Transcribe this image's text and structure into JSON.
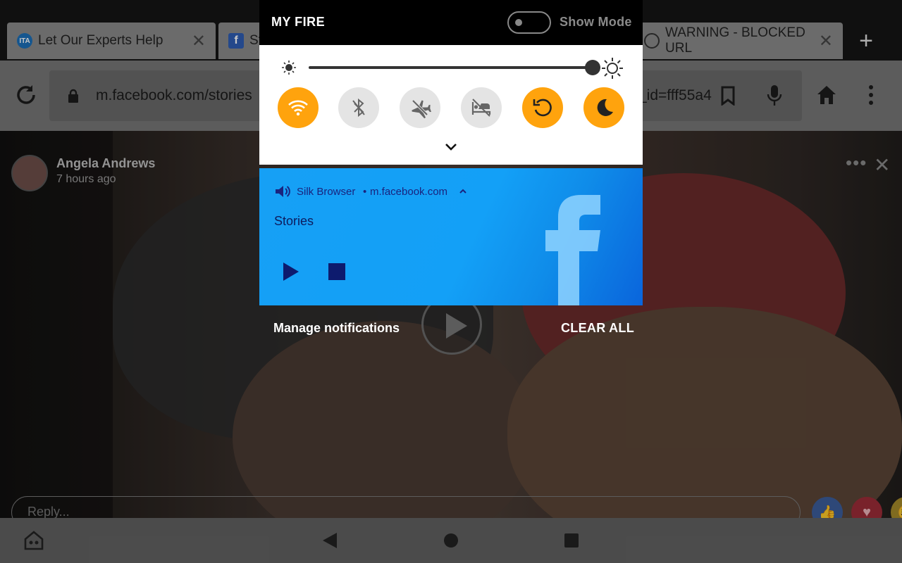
{
  "tabs": [
    {
      "label": "Let Our Experts Help",
      "icon": "ita-favicon",
      "favicon_text": "ITA"
    },
    {
      "label": "St",
      "icon": "facebook-favicon",
      "favicon_text": "f"
    },
    {
      "label": "WARNING - BLOCKED URL",
      "icon": "warning-favicon",
      "favicon_text": ""
    }
  ],
  "tab_close_glyph": "✕",
  "new_tab_glyph": "+",
  "address_bar": {
    "url_start": "m.facebook.com/stories",
    "url_end": "_id=fff55a4"
  },
  "story": {
    "author": "Angela Andrews",
    "time": "7 hours ago",
    "more_glyph": "•••",
    "close_glyph": "✕",
    "reply_placeholder": "Reply..."
  },
  "reactions": {
    "like": "👍",
    "love": "♥",
    "haha": "😆"
  },
  "shade": {
    "title": "MY FIRE",
    "show_mode_label": "Show Mode",
    "show_mode_on": false,
    "brightness_level": 1.0,
    "quick_settings": [
      {
        "name": "wifi",
        "on": true
      },
      {
        "name": "bluetooth",
        "on": false
      },
      {
        "name": "airplane-mode",
        "on": false
      },
      {
        "name": "do-not-disturb-bed",
        "on": false
      },
      {
        "name": "auto-rotate",
        "on": true
      },
      {
        "name": "blue-shade",
        "on": true
      }
    ],
    "accent_color": "#ffa30d"
  },
  "media_notification": {
    "app": "Silk Browser",
    "separator": "•",
    "site": "m.facebook.com",
    "title": "Stories"
  },
  "actions": {
    "manage": "Manage notifications",
    "clear_all": "CLEAR ALL"
  }
}
